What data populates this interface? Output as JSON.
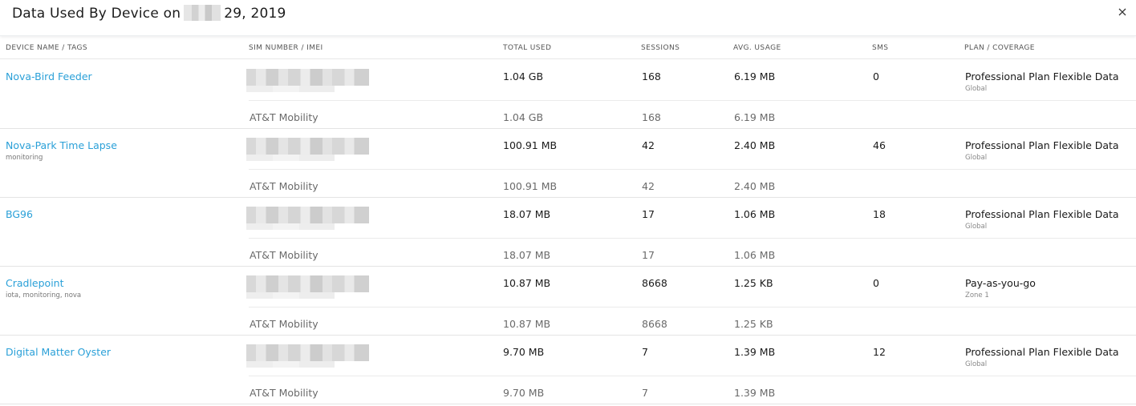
{
  "header": {
    "title_prefix": "Data Used By Device on",
    "title_suffix": "29, 2019",
    "close_icon": "close-icon"
  },
  "columns": {
    "device": "DEVICE NAME / TAGS",
    "sim": "SIM NUMBER / IMEI",
    "total": "TOTAL USED",
    "sessions": "SESSIONS",
    "avg": "AVG. USAGE",
    "sms": "SMS",
    "plan": "PLAN / COVERAGE"
  },
  "rows": [
    {
      "name": "Nova-Bird Feeder",
      "tags": "",
      "total": "1.04 GB",
      "sessions": "168",
      "avg": "6.19 MB",
      "sms": "0",
      "plan": "Professional Plan Flexible Data",
      "coverage": "Global",
      "carrier": "AT&T Mobility",
      "carrier_total": "1.04 GB",
      "carrier_sessions": "168",
      "carrier_avg": "6.19 MB"
    },
    {
      "name": "Nova-Park Time Lapse",
      "tags": "monitoring",
      "total": "100.91 MB",
      "sessions": "42",
      "avg": "2.40 MB",
      "sms": "46",
      "plan": "Professional Plan Flexible Data",
      "coverage": "Global",
      "carrier": "AT&T Mobility",
      "carrier_total": "100.91 MB",
      "carrier_sessions": "42",
      "carrier_avg": "2.40 MB"
    },
    {
      "name": "BG96",
      "tags": "",
      "total": "18.07 MB",
      "sessions": "17",
      "avg": "1.06 MB",
      "sms": "18",
      "plan": "Professional Plan Flexible Data",
      "coverage": "Global",
      "carrier": "AT&T Mobility",
      "carrier_total": "18.07 MB",
      "carrier_sessions": "17",
      "carrier_avg": "1.06 MB"
    },
    {
      "name": "Cradlepoint",
      "tags": "iota, monitoring, nova",
      "total": "10.87 MB",
      "sessions": "8668",
      "avg": "1.25 KB",
      "sms": "0",
      "plan": "Pay-as-you-go",
      "coverage": "Zone 1",
      "carrier": "AT&T Mobility",
      "carrier_total": "10.87 MB",
      "carrier_sessions": "8668",
      "carrier_avg": "1.25 KB"
    },
    {
      "name": "Digital Matter Oyster",
      "tags": "",
      "total": "9.70 MB",
      "sessions": "7",
      "avg": "1.39 MB",
      "sms": "12",
      "plan": "Professional Plan Flexible Data",
      "coverage": "Global",
      "carrier": "AT&T Mobility",
      "carrier_total": "9.70 MB",
      "carrier_sessions": "7",
      "carrier_avg": "1.39 MB"
    }
  ]
}
